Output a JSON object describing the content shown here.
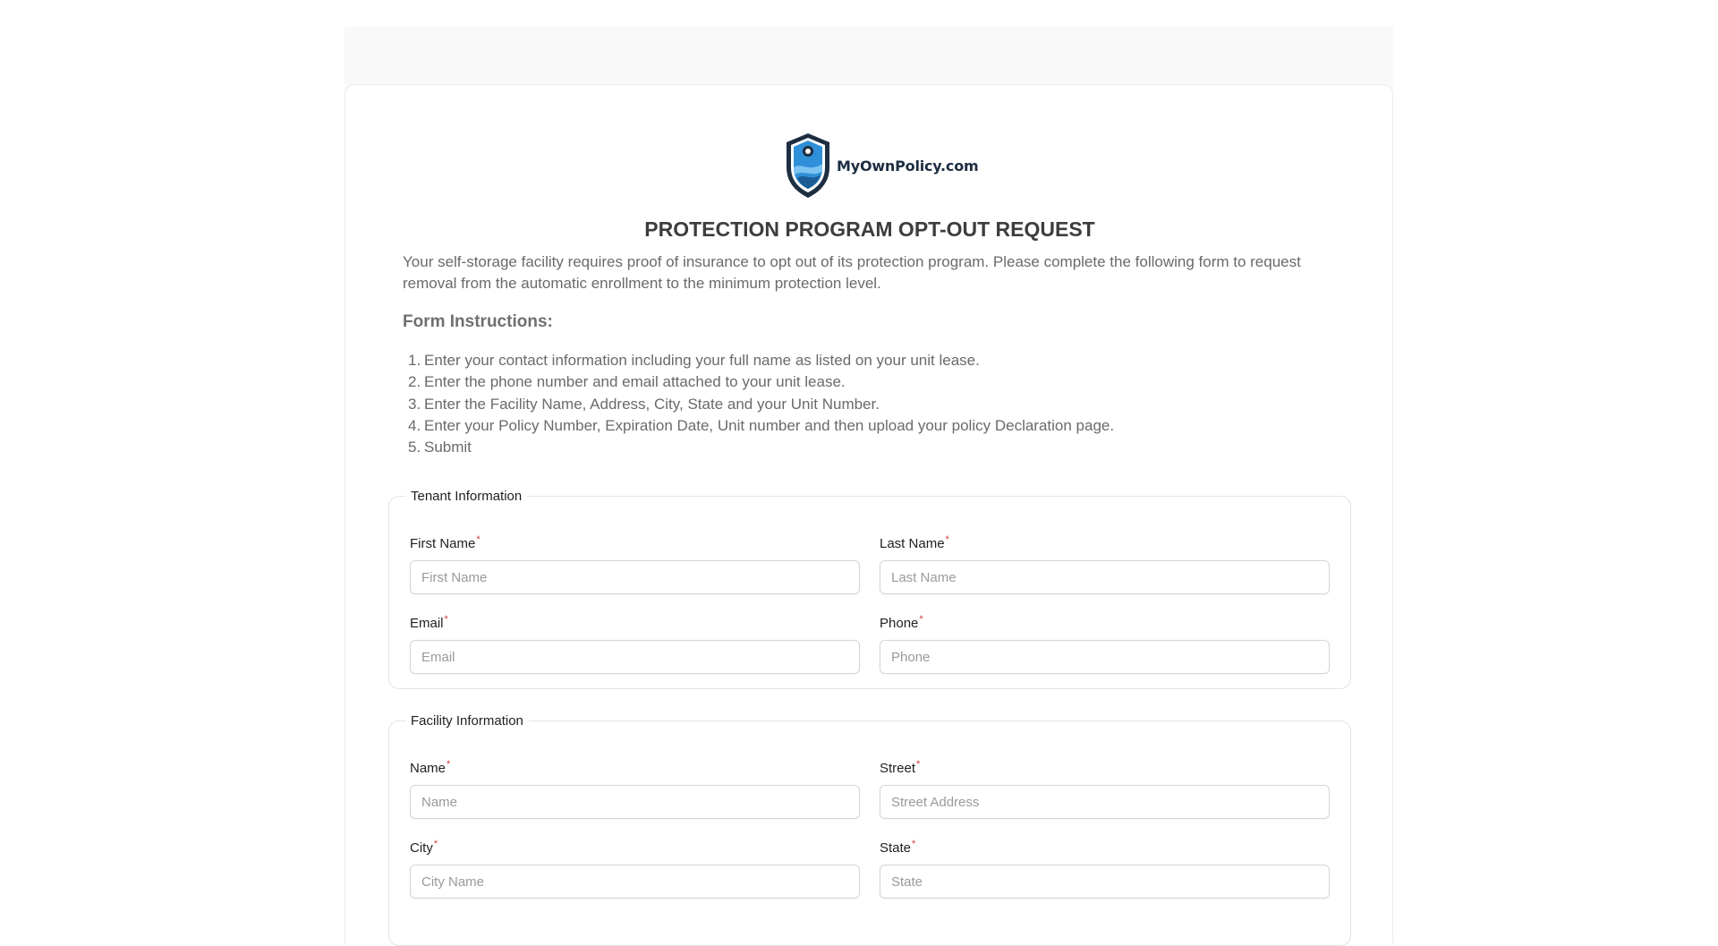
{
  "brand": {
    "name": "MyOwnPolicy.com",
    "colors": {
      "navy": "#1d2e40",
      "blue": "#2f8fd8",
      "required": "#d9363e"
    }
  },
  "title": "PROTECTION PROGRAM OPT-OUT REQUEST",
  "intro": "Your self-storage facility requires proof of insurance to opt out of its protection program. Please complete the following form to request removal from the automatic enrollment to the minimum protection level.",
  "instructions": {
    "heading": "Form Instructions:",
    "items": [
      {
        "num": "1.",
        "text": "Enter your contact information including your full name as listed on your unit lease."
      },
      {
        "num": "2.",
        "text": "Enter the phone number and email attached to your unit lease."
      },
      {
        "num": "3.",
        "text": "Enter the Facility Name, Address, City, State and your Unit Number."
      },
      {
        "num": "4.",
        "text": "Enter your Policy Number, Expiration Date, Unit number and then upload your policy Declaration page."
      },
      {
        "num": "5.",
        "text": "Submit"
      }
    ]
  },
  "tenant": {
    "legend": "Tenant Information",
    "first_name": {
      "label": "First Name",
      "placeholder": "First Name",
      "value": ""
    },
    "last_name": {
      "label": "Last Name",
      "placeholder": "Last Name",
      "value": ""
    },
    "email": {
      "label": "Email",
      "placeholder": "Email",
      "value": ""
    },
    "phone": {
      "label": "Phone",
      "placeholder": "Phone",
      "value": ""
    }
  },
  "facility": {
    "legend": "Facility Information",
    "name": {
      "label": "Name",
      "placeholder": "Name",
      "value": ""
    },
    "street": {
      "label": "Street",
      "placeholder": "Street Address",
      "value": ""
    },
    "city": {
      "label": "City",
      "placeholder": "City Name",
      "value": ""
    },
    "state": {
      "label": "State",
      "placeholder": "State",
      "value": ""
    }
  },
  "required_marker": "*"
}
